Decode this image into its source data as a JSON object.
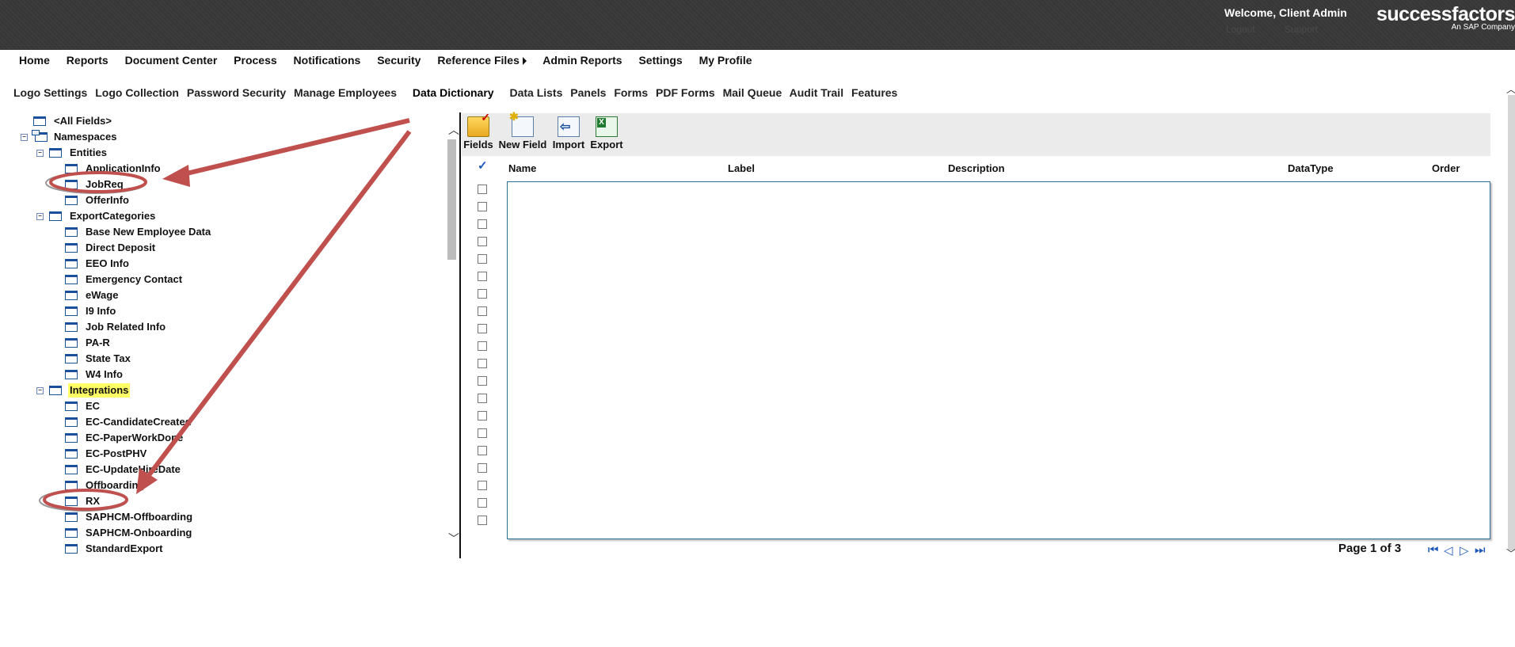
{
  "header": {
    "welcome": "Welcome, Client Admin",
    "logout": "Logout",
    "support": "Support",
    "brand": "successfactors",
    "brand_sub": "An SAP Company"
  },
  "main_nav": [
    "Home",
    "Reports",
    "Document Center",
    "Process",
    "Notifications",
    "Security",
    "Reference Files",
    "Admin Reports",
    "Settings",
    "My Profile"
  ],
  "sub_nav": {
    "items": [
      "Logo Settings",
      "Logo Collection",
      "Password Security",
      "Manage Employees"
    ],
    "active": "Data Dictionary",
    "items_after": [
      "Data Lists",
      "Panels",
      "Forms",
      "PDF Forms",
      "Mail Queue",
      "Audit Trail",
      "Features"
    ]
  },
  "tree": {
    "all_fields": "<All Fields>",
    "namespaces": "Namespaces",
    "entities": {
      "label": "Entities",
      "children": [
        "ApplicationInfo",
        "JobReq",
        "OfferInfo"
      ]
    },
    "export_categories": {
      "label": "ExportCategories",
      "children": [
        "Base New Employee Data",
        "Direct Deposit",
        "EEO Info",
        "Emergency Contact",
        "eWage",
        "I9 Info",
        "Job Related Info",
        "PA-R",
        "State Tax",
        "W4 Info"
      ]
    },
    "integrations": {
      "label": "Integrations",
      "children": [
        "EC",
        "EC-CandidateCreated",
        "EC-PaperWorkDone",
        "EC-PostPHV",
        "EC-UpdateHireDate",
        "Offboarding",
        "RX",
        "SAPHCM-Offboarding",
        "SAPHCM-Onboarding",
        "StandardExport"
      ]
    },
    "highlight_color": "#ffff66"
  },
  "toolbar": {
    "fields": "Fields",
    "new_field": "New Field",
    "import": "Import",
    "export": "Export"
  },
  "grid": {
    "columns": [
      "Name",
      "Label",
      "Description",
      "DataType",
      "Order"
    ],
    "row_count": 20
  },
  "pager": {
    "text": "Page 1 of 3"
  },
  "annotation_color": "#c0504d"
}
